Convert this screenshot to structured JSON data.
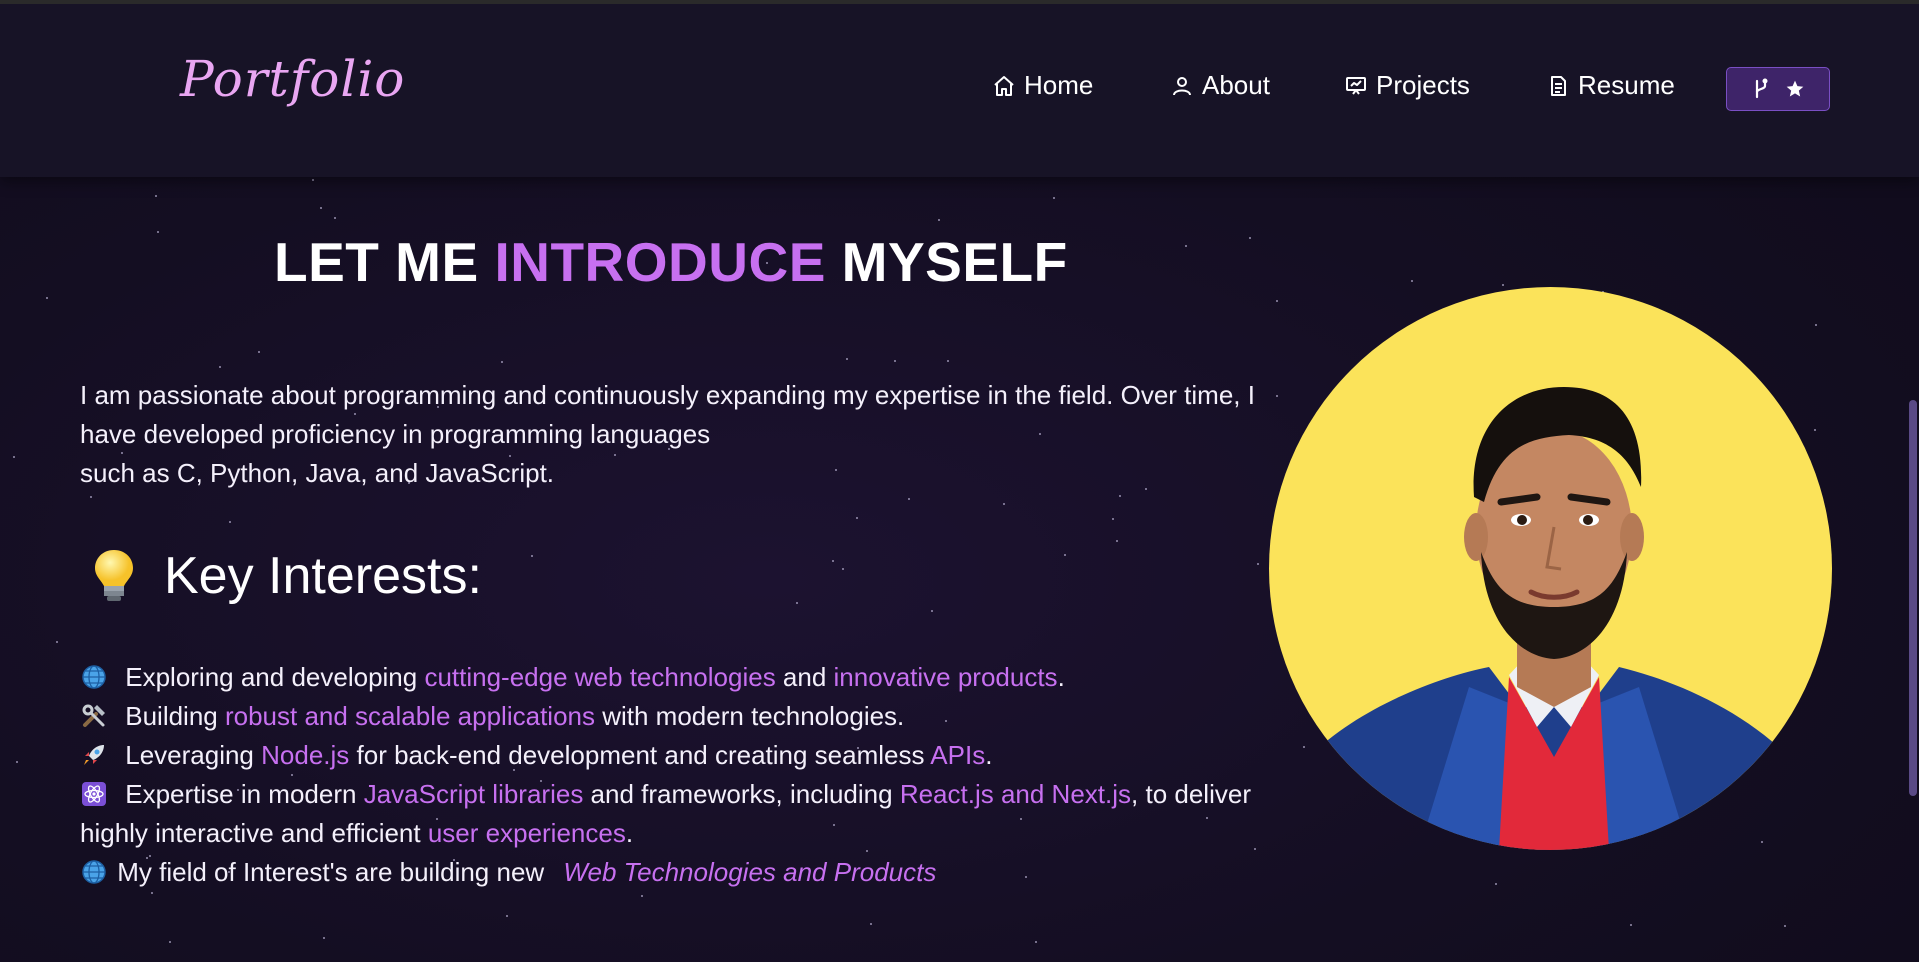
{
  "navbar": {
    "logo": "Portfolio",
    "items": [
      {
        "label": "Home",
        "icon": "home-icon"
      },
      {
        "label": "About",
        "icon": "user-icon"
      },
      {
        "label": "Projects",
        "icon": "presentation-icon"
      },
      {
        "label": "Resume",
        "icon": "document-icon"
      }
    ],
    "github_button": {
      "icons": [
        "git-fork-icon",
        "star-icon"
      ]
    }
  },
  "about": {
    "heading": {
      "part1": "LET ME ",
      "highlight": "INTRODUCE",
      "part2": " MYSELF"
    },
    "intro": [
      "I am passionate about programming and continuously expanding my expertise in the field. Over time, I have developed proficiency in programming languages",
      "such as C, Python, Java, and JavaScript."
    ],
    "interests_title": "Key Interests:",
    "interests": [
      {
        "icon": "globe-icon",
        "t1": "Exploring and developing ",
        "h1": "cutting-edge web technologies",
        "t2": " and ",
        "h2": "innovative products",
        "t3": "."
      },
      {
        "icon": "tools-icon",
        "t1": "Building ",
        "h1": "robust and scalable applications",
        "t2": " with modern technologies."
      },
      {
        "icon": "rocket-icon",
        "t1": "Leveraging ",
        "h1": "Node.js",
        "t2": " for back-end development and creating seamless ",
        "h2": "APIs",
        "t3": "."
      },
      {
        "icon": "atom-icon",
        "t1": "Expertise in modern ",
        "h1": "JavaScript libraries",
        "t2": " and frameworks, including ",
        "h2": "React.js and Next.js",
        "t3": ", to deliver highly interactive and efficient ",
        "h3": "user experiences",
        "t4": "."
      },
      {
        "icon": "globe-icon",
        "t1": "My field of Interest's are building new ",
        "h1": "Web Technologies and Products"
      }
    ],
    "colors": {
      "accent": "#c770f0",
      "background": "#140e22",
      "navbar": "#181426",
      "avatar_bg": "#fbe35a"
    }
  }
}
